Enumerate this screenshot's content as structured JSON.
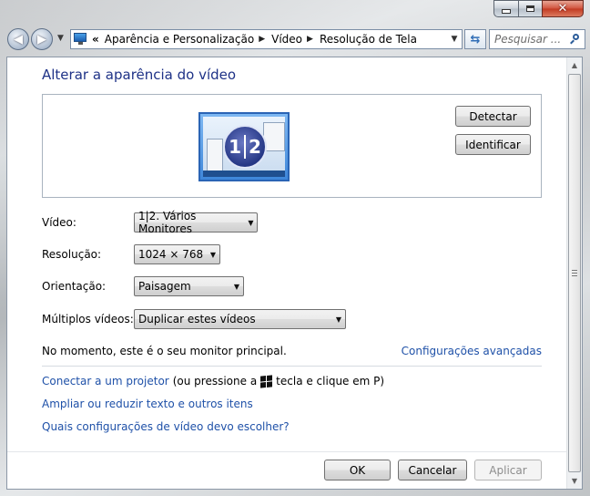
{
  "window": {
    "caption": {
      "minimize": "—",
      "maximize": "□",
      "close": "✕"
    }
  },
  "nav": {
    "back_icon": "back-arrow-icon",
    "forward_icon": "forward-arrow-icon",
    "breadcrumb_prefix": "«",
    "breadcrumbs": [
      "Aparência e Personalização",
      "Vídeo",
      "Resolução de Tela"
    ],
    "search_placeholder": "Pesquisar ..."
  },
  "page": {
    "title": "Alterar a aparência do vídeo",
    "monitor_badge": {
      "left": "1",
      "right": "2"
    },
    "detect_button": "Detectar",
    "identify_button": "Identificar",
    "settings": [
      {
        "label": "Vídeo:",
        "value": "1|2. Vários Monitores"
      },
      {
        "label": "Resolução:",
        "value": "1024 × 768"
      },
      {
        "label": "Orientação:",
        "value": "Paisagem"
      },
      {
        "label": "Múltiplos vídeos:",
        "value": "Duplicar estes vídeos"
      }
    ],
    "status_text": "No momento, este é o seu monitor principal.",
    "advanced_link": "Configurações avançadas",
    "projector_link": "Conectar a um projetor",
    "projector_pre": "(ou pressione a",
    "projector_post": "tecla e clique em P)",
    "text_size_link": "Ampliar ou reduzir texto e outros itens",
    "help_link": "Quais configurações de vídeo devo escolher?"
  },
  "footer": {
    "ok": "OK",
    "cancel": "Cancelar",
    "apply": "Aplicar"
  },
  "colors": {
    "link": "#1f51a8",
    "title": "#1e3287"
  }
}
